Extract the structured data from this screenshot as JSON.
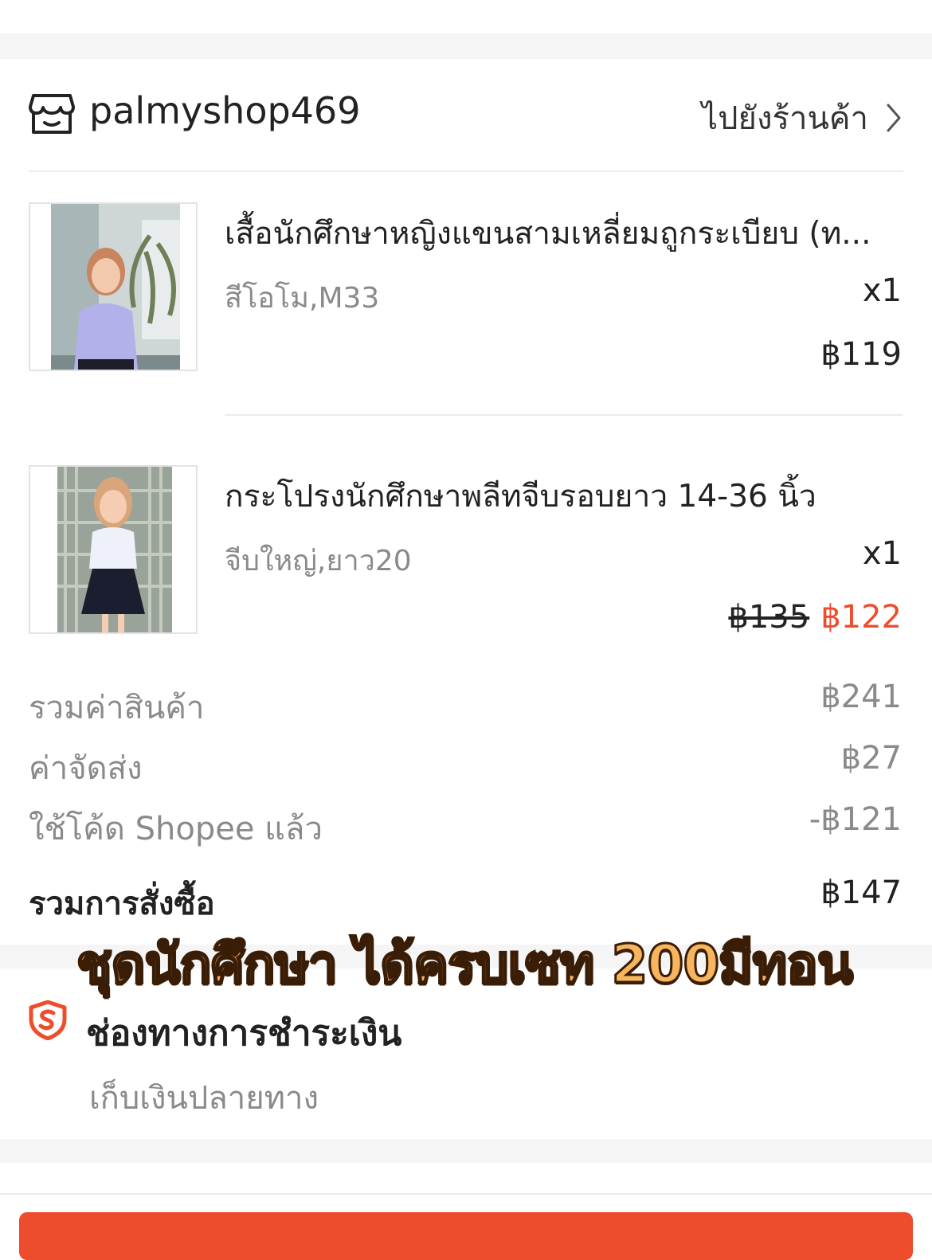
{
  "shop": {
    "name": "palmyshop469",
    "goto_label": "ไปยังร้านค้า",
    "store_icon": "store-icon",
    "chevron_icon": "chevron-right-icon"
  },
  "items": [
    {
      "title": "เสื้อนักศึกษาหญิงแขนสามเหลี่ยมถูกระเบียบ (ท...",
      "variant": "สีโอโม,M33",
      "qty": "x1",
      "price": "฿119"
    },
    {
      "title": "กระโปรงนักศึกษาพลีทจีบรอบยาว 14-36 นิ้ว",
      "variant": "จีบใหญ่,ยาว20",
      "qty": "x1",
      "price_original": "฿135",
      "price": "฿122"
    }
  ],
  "summary": {
    "subtotal_label": "รวมค่าสินค้า",
    "subtotal_value": "฿241",
    "shipping_label": "ค่าจัดส่ง",
    "shipping_value": "฿27",
    "voucher_label": "ใช้โค้ด Shopee แล้ว",
    "voucher_value": "-฿121",
    "total_label": "รวมการสั่งซื้อ",
    "total_value": "฿147"
  },
  "overlay_caption": "ชุดนักศึกษา ได้ครบเซท 200มีทอน",
  "payment": {
    "title": "ช่องทางการชำระเงิน",
    "method": "เก็บเงินปลายทาง",
    "icon": "shopee-shield-icon"
  },
  "colors": {
    "accent": "#ee4d2d",
    "caption_fill": "#f7b65d",
    "caption_stroke": "#3a1d06"
  }
}
